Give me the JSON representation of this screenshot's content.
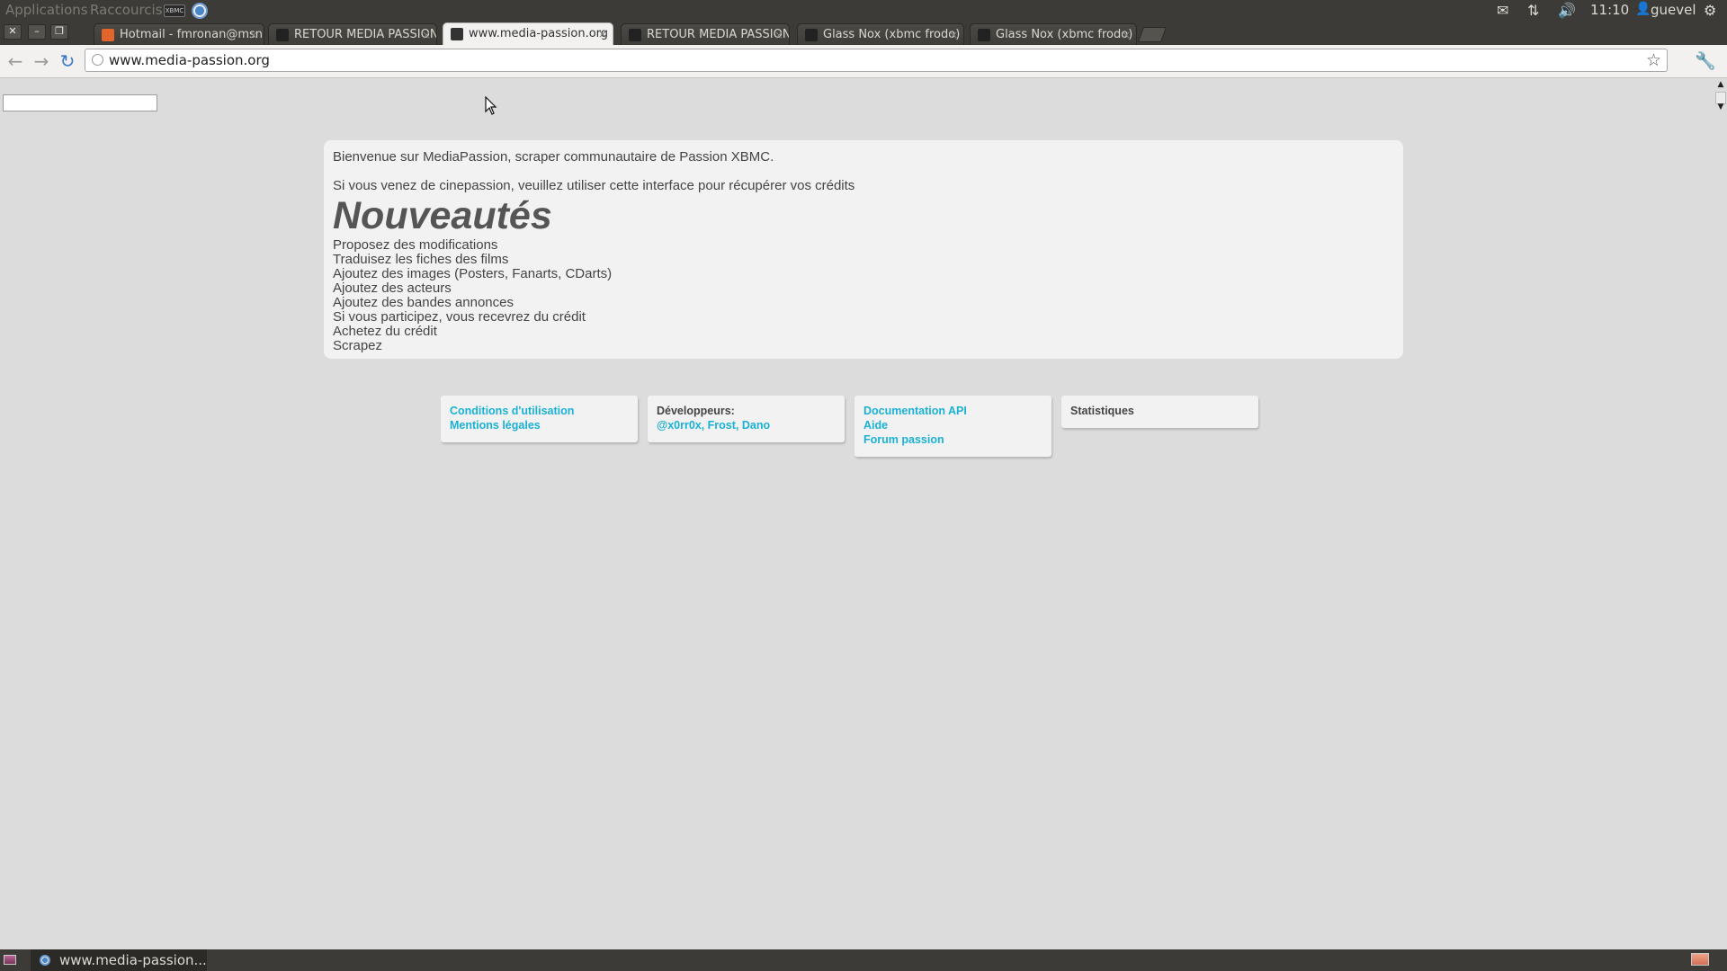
{
  "system_panel": {
    "applications": "Applications",
    "shortcuts": "Raccourcis",
    "xbmc_chip": "XBMC",
    "time": "11:10",
    "user": "guevel",
    "icons": [
      "mail-icon",
      "network-icon",
      "volume-icon",
      "user-icon",
      "gear-icon"
    ]
  },
  "tabs": [
    {
      "title": "Hotmail - fmronan@msn.com",
      "favicon_color": "#e2662c",
      "active": false
    },
    {
      "title": "RETOUR MEDIA PASSION",
      "favicon_color": "#222222",
      "active": false
    },
    {
      "title": "www.media-passion.org",
      "favicon_color": "#333333",
      "active": true
    },
    {
      "title": "RETOUR MEDIA PASSION",
      "favicon_color": "#222222",
      "active": false
    },
    {
      "title": "Glass Nox (xbmc frodo)",
      "favicon_color": "#222222",
      "active": false
    },
    {
      "title": "Glass Nox (xbmc frodo)",
      "favicon_color": "#222222",
      "active": false
    }
  ],
  "window_controls": {
    "close": "✕",
    "minimize": "–",
    "restore": "❐"
  },
  "toolbar": {
    "back_icon": "←",
    "forward_icon": "→",
    "reload_icon": "↻",
    "url": "www.media-passion.org",
    "star_icon": "☆",
    "wrench_icon": "🔧"
  },
  "page": {
    "search_value": "",
    "intro_1": "Bienvenue sur MediaPassion, scraper communautaire de Passion XBMC.",
    "intro_2": "Si vous venez de cinepassion, veuillez utiliser cette interface pour récupérer vos crédits",
    "heading": "Nouveautés",
    "features": [
      "Proposez des modifications",
      "Traduisez les fiches des films",
      "Ajoutez des images (Posters, Fanarts, CDarts)",
      "Ajoutez des acteurs",
      "Ajoutez des bandes annonces",
      "Si vous participez, vous recevrez du crédit",
      "Achetez du crédit",
      "Scrapez"
    ],
    "footer": {
      "legal": {
        "terms": "Conditions d'utilisation",
        "mentions": "Mentions légales"
      },
      "developers": {
        "label": "Développeurs:",
        "names": "@x0rr0x, Frost, Dano"
      },
      "docs": {
        "api": "Documentation API",
        "help": "Aide",
        "forum": "Forum passion"
      },
      "stats": {
        "label": "Statistiques"
      }
    }
  },
  "taskbar": {
    "item": "www.media-passion...."
  },
  "colors": {
    "link": "#1ab1d6",
    "panel": "#3c3b37",
    "page_bg": "#dcdcdc",
    "card_bg": "#f2f2f2"
  }
}
